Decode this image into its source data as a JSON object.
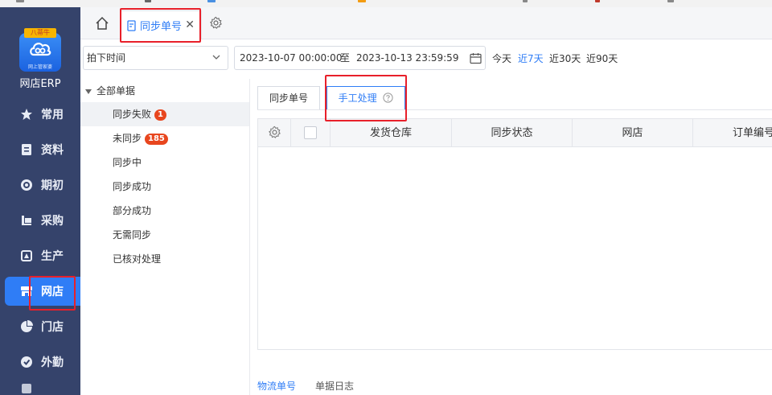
{
  "sidebar": {
    "logo_ribbon": "八蒂牛",
    "logo_sub": "网上管家婆",
    "app_name": "网店ERP",
    "items": [
      {
        "label": "常用",
        "icon": "star-icon"
      },
      {
        "label": "资料",
        "icon": "document-icon"
      },
      {
        "label": "期初",
        "icon": "target-icon"
      },
      {
        "label": "采购",
        "icon": "purchase-icon"
      },
      {
        "label": "生产",
        "icon": "production-icon"
      },
      {
        "label": "网店",
        "icon": "store-icon",
        "active": true
      },
      {
        "label": "门店",
        "icon": "pie-icon"
      },
      {
        "label": "外勤",
        "icon": "field-icon"
      }
    ]
  },
  "tabs": {
    "active_tab": "同步单号"
  },
  "filter": {
    "time_field": "拍下时间",
    "date_start": "2023-10-07 00:00:00",
    "date_sep": "至",
    "date_end": "2023-10-13 23:59:59",
    "quick": [
      {
        "label": "今天",
        "active": false
      },
      {
        "label": "近7天",
        "active": true
      },
      {
        "label": "近30天",
        "active": false
      },
      {
        "label": "近90天",
        "active": false
      }
    ]
  },
  "tree": {
    "root": "全部单据",
    "items": [
      {
        "label": "同步失败",
        "badge": "1"
      },
      {
        "label": "未同步",
        "badge": "185"
      },
      {
        "label": "同步中"
      },
      {
        "label": "同步成功"
      },
      {
        "label": "部分成功"
      },
      {
        "label": "无需同步"
      },
      {
        "label": "已核对处理"
      }
    ]
  },
  "subtabs": {
    "sync": "同步单号",
    "manual": "手工处理"
  },
  "grid": {
    "columns": [
      "发货仓库",
      "同步状态",
      "网店",
      "订单编号"
    ]
  },
  "bottom": {
    "logistics": "物流单号",
    "log": "单据日志"
  },
  "colors": {
    "accent": "#2f7df6",
    "sidebar": "#35436b",
    "badge": "#e8461e",
    "highlight": "#e8202a"
  }
}
